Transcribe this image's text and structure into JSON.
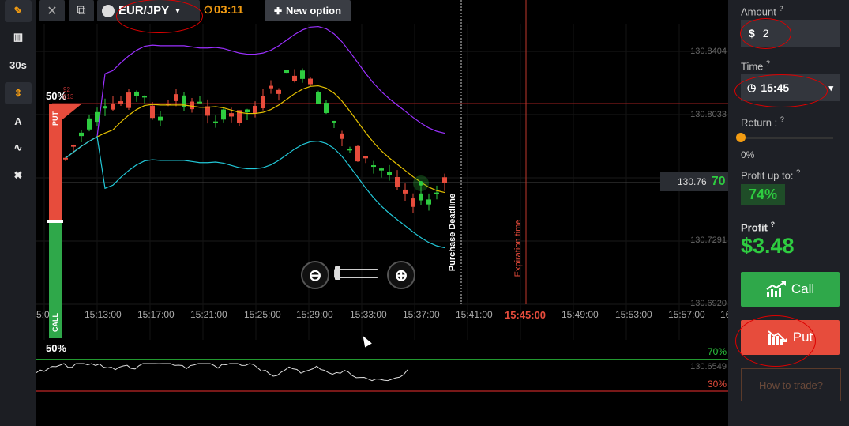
{
  "toolbar": {
    "items": [
      {
        "name": "pencil-icon",
        "glyph": "✎"
      },
      {
        "name": "indicators-icon",
        "glyph": "▥"
      },
      {
        "name": "timeframe",
        "glyph": "30s"
      },
      {
        "name": "chart-type-icon",
        "glyph": "⇕"
      },
      {
        "name": "drawing-tools-icon",
        "glyph": "A"
      },
      {
        "name": "trend-icon",
        "glyph": "∿"
      },
      {
        "name": "clear-icon",
        "glyph": "✖"
      }
    ]
  },
  "topbar": {
    "close_glyph": "✕",
    "windows_glyph": "⧉",
    "asset": "EUR/JPY",
    "asset_arrow": "▾",
    "timer": "03:11",
    "timer_glyph": "⏱",
    "new_option_glyph": "✚",
    "new_option": "New option"
  },
  "chart": {
    "price_labels": [
      "130.8404",
      "130.8033",
      "130.7291",
      "130.6920"
    ],
    "time_labels": [
      "5:0",
      "15:13:00",
      "15:17:00",
      "15:21:00",
      "15:25:00",
      "15:29:00",
      "15:33:00",
      "15:37:00",
      "15:41:00",
      "15:45:00",
      "15:49:00",
      "15:53:00",
      "15:57:00",
      "16"
    ],
    "expiry_time": "15:45:00",
    "current_price": "130.76",
    "current_payout": "70",
    "put_percent": "50%",
    "call_percent": "50%",
    "put_tag": "PUT",
    "call_tag": "CALL",
    "put_small_top": "92",
    "put_small_bottom": "813",
    "purchase_deadline": "Purchase Deadline",
    "expiration_time": "Expiration time",
    "zoom_out_glyph": "⊖",
    "zoom_in_glyph": "⊕",
    "osc_upper": "70%",
    "osc_lower": "30%",
    "osc_price": "130.6549",
    "colors": {
      "up": "#2ecc40",
      "down": "#e74c3c",
      "upper_band": "#9b30ff",
      "middle_band": "#e6c200",
      "lower_band": "#22c8d8",
      "oscillator": "#dddddd"
    }
  },
  "panel": {
    "amount_label": "Amount",
    "help_glyph": "?",
    "amount_currency": "$",
    "amount_value": "2",
    "time_label": "Time",
    "time_glyph": "◷",
    "time_value": "15:45",
    "time_arrow": "▾",
    "return_label": "Return :",
    "return_value": "0%",
    "return_level": 0,
    "profit_upto_label": "Profit up to:",
    "profit_upto_value": "74%",
    "profit_label": "Profit",
    "profit_value": "$3.48",
    "call_label": "Call",
    "put_label": "Put",
    "howto_label": "How to trade?"
  }
}
